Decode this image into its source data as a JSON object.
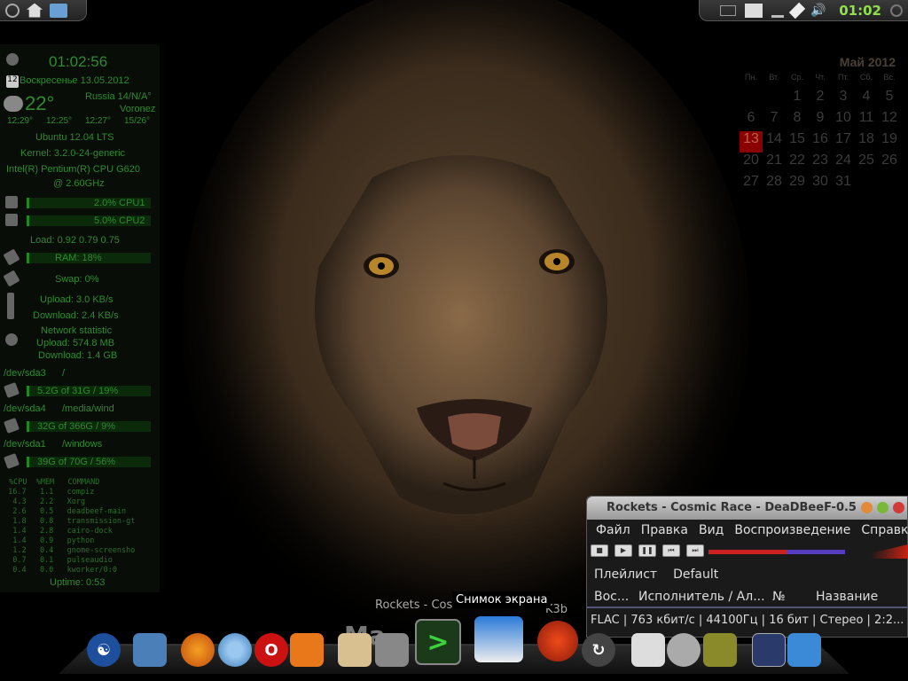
{
  "top_panel": {
    "clock": "01:02"
  },
  "conky": {
    "time": "01:02:56",
    "date": "Воскресенье 13.05.2012",
    "date_icon_day": "12",
    "temperature": "22°",
    "location_line1": "Russia 14/N/A°",
    "location_line2": "Voronez",
    "forecast": [
      "12:29°",
      "12:25°",
      "12:27°",
      "15/26°"
    ],
    "os": "Ubuntu 12.04 LTS",
    "kernel": "Kernel: 3.2.0-24-generic",
    "cpu_model_1": "Intel(R) Pentium(R) CPU G620",
    "cpu_model_2": "@ 2.60GHz",
    "cpu1": "2.0% CPU1",
    "cpu2": "5.0% CPU2",
    "load": "Load: 0.92 0.79 0.75",
    "ram": "RAM: 18%",
    "swap": "Swap: 0%",
    "upload": "Upload: 3.0 KB/s",
    "download": "Download: 2.4 KB/s",
    "net_title": "Network statistic",
    "net_up": "Upload: 574.8 MB",
    "net_down": "Download: 1.4 GB",
    "disk1_dev": "/dev/sda3",
    "disk1_mount": "/",
    "disk1_usage": "5.2G of 31G / 19%",
    "disk2_dev": "/dev/sda4",
    "disk2_mount": "/media/wind",
    "disk2_usage": "32G of 366G / 9%",
    "disk3_dev": "/dev/sda1",
    "disk3_mount": "/windows",
    "disk3_usage": "39G of 70G / 56%",
    "top_header": "%CPU  %MEM   COMMAND",
    "top_rows": [
      " 16.7   1.1   compiz",
      "  4.3   2.2   Xorg",
      "  2.6   0.5   deadbeef-main",
      "  1.8   0.8   transmission-gt",
      "  1.4   2.8   cairo-dock",
      "  1.4   0.9   python",
      "  1.2   0.4   gnome-screensho",
      "  0.7   0.1   pulseaudio",
      "  0.4   0.0   kworker/0:0"
    ],
    "uptime": "Uptime: 0:53"
  },
  "calendar": {
    "month": "Май 2012",
    "weekdays": [
      "Пн.",
      "Вт.",
      "Ср.",
      "Чт.",
      "Пт.",
      "Сб.",
      "Вс."
    ],
    "days": [
      "",
      "",
      "1",
      "2",
      "3",
      "4",
      "5",
      "6",
      "7",
      "8",
      "9",
      "10",
      "11",
      "12",
      "13",
      "14",
      "15",
      "16",
      "17",
      "18",
      "19",
      "20",
      "21",
      "22",
      "23",
      "24",
      "25",
      "26",
      "27",
      "28",
      "29",
      "30",
      "31"
    ],
    "today": "13"
  },
  "player": {
    "title": "Rockets - Cosmic Race - DeaDBeeF-0.5",
    "menu": [
      "Файл",
      "Правка",
      "Вид",
      "Воспроизведение",
      "Справка"
    ],
    "tabs": [
      "Плейлист",
      "Default"
    ],
    "columns": [
      "Вос...",
      "Исполнитель / Ал...",
      "№",
      "Название"
    ],
    "status": "FLAC |  763 кбит/с | 44100Гц | 16 бит | Стерео | 2:2...",
    "progress": 0.58,
    "colors": {
      "seek_fill": "#cc2222",
      "seek_bg": "#553cc0"
    }
  },
  "dock": {
    "tooltip": "Снимок экрана",
    "window_label": "Rockets - Cosmic Race - ...",
    "k3b_label": "K3b",
    "watermark": "Ma"
  }
}
